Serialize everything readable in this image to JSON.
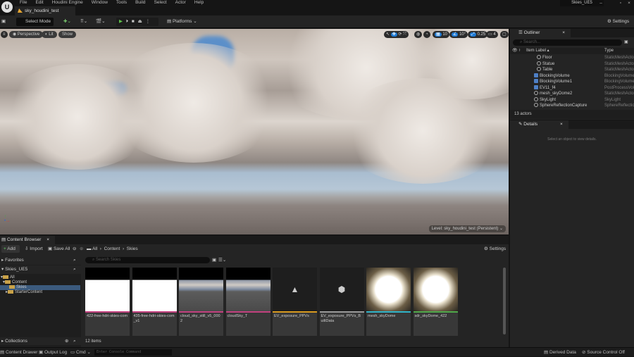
{
  "menu": [
    "File",
    "Edit",
    "Houdini Engine",
    "Window",
    "Tools",
    "Build",
    "Select",
    "Actor",
    "Help"
  ],
  "document_tab": "sky_houdini_test",
  "project_name": "Skies_UE5",
  "toolbar": {
    "select_mode": "Select Mode",
    "platforms": "Platforms",
    "settings": "Settings"
  },
  "viewport": {
    "perspective": "Perspective",
    "lit": "Lit",
    "show": "Show",
    "grid_snap": "10",
    "rotation_snap": "10°",
    "scale_snap": "0.25",
    "camera_speed": "4",
    "level": "Level: sky_houdini_test (Persistent)"
  },
  "outliner": {
    "title": "Outliner",
    "search_placeholder": "Search...",
    "col_label": "Item Label ▴",
    "col_type": "Type",
    "rows": [
      {
        "label": "Floor",
        "type": "StaticMeshActor",
        "icon": "mesh"
      },
      {
        "label": "Statue",
        "type": "StaticMeshActor",
        "icon": "mesh"
      },
      {
        "label": "Table",
        "type": "StaticMeshActor",
        "icon": "mesh"
      },
      {
        "label": "BlockingVolume",
        "type": "BlockingVolume",
        "icon": "volume"
      },
      {
        "label": "BlockingVolume1",
        "type": "BlockingVolume",
        "icon": "volume"
      },
      {
        "label": "EV11_f4",
        "type": "PostProcessVolume",
        "icon": "volume"
      },
      {
        "label": "mesh_skyDome2",
        "type": "StaticMeshActor",
        "icon": "mesh"
      },
      {
        "label": "SkyLight",
        "type": "SkyLight",
        "icon": "light"
      },
      {
        "label": "SphereReflectionCapture",
        "type": "SphereReflectionCapture",
        "icon": "capture"
      }
    ],
    "count": "13 actors"
  },
  "details": {
    "title": "Details",
    "empty": "Select an object to view details."
  },
  "content_browser": {
    "title": "Content Browser",
    "add": "Add",
    "import": "Import",
    "save_all": "Save All",
    "breadcrumb": [
      "All",
      "Content",
      "Skies"
    ],
    "settings": "Settings",
    "favorites": "Favorites",
    "project": "Skies_UE5",
    "tree": [
      "All",
      "Content",
      "Skies",
      "StarterContent"
    ],
    "collections": "Collections",
    "search_placeholder": "Search Skies",
    "assets": [
      {
        "name": "422-free-hdri-skies-com",
        "color": "#c2407e",
        "thumb": "white"
      },
      {
        "name": "435-free-hdri-skies-com_v1",
        "color": "#c2407e",
        "thumb": "white"
      },
      {
        "name": "cloud_sky_still_v5_0002",
        "color": "#c2407e",
        "thumb": "pano"
      },
      {
        "name": "cloudSky_T",
        "color": "#c2407e",
        "thumb": "pano"
      },
      {
        "name": "EV_exposure_PPVs",
        "color": "#d89a1f",
        "thumb": "icon"
      },
      {
        "name": "EV_exposure_PPVs_BuiltData",
        "color": "#9a9a9a",
        "thumb": "cube"
      },
      {
        "name": "mesh_skyDome",
        "color": "#2fb3c9",
        "thumb": "sphere"
      },
      {
        "name": "sdr_skyDome_422",
        "color": "#4fa84a",
        "thumb": "sphere"
      }
    ],
    "count": "12 items"
  },
  "statusbar": {
    "content_drawer": "Content Drawer",
    "output_log": "Output Log",
    "cmd": "Cmd",
    "console_placeholder": "Enter Console Command",
    "derived_data": "Derived Data",
    "source_control": "Source Control Off"
  }
}
